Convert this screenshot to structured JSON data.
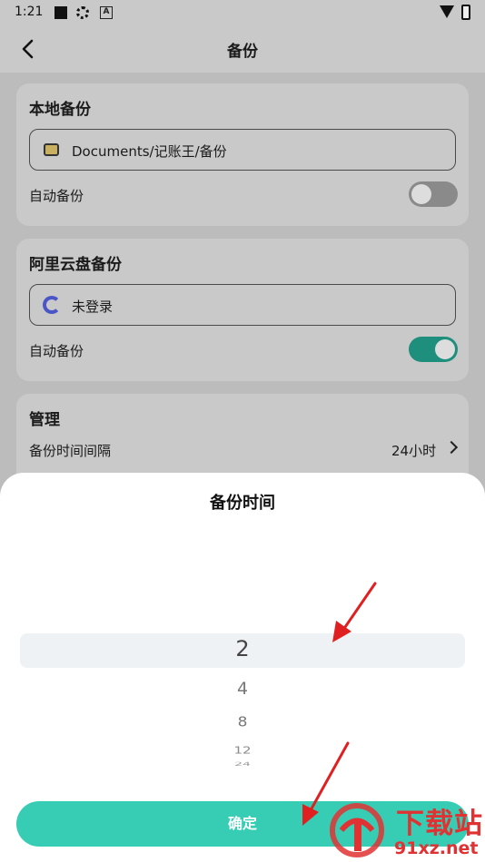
{
  "status_bar": {
    "time": "1:21"
  },
  "header": {
    "title": "备份"
  },
  "local_backup": {
    "title": "本地备份",
    "path": "Documents/记账王/备份",
    "auto_label": "自动备份",
    "auto_enabled": false
  },
  "cloud_backup": {
    "title": "阿里云盘备份",
    "account": "未登录",
    "auto_label": "自动备份",
    "auto_enabled": true
  },
  "manage": {
    "title": "管理",
    "interval_label": "备份时间间隔",
    "interval_value": "24小时"
  },
  "sheet": {
    "title": "备份时间",
    "picker_options": [
      "2",
      "4",
      "8",
      "12",
      "24"
    ],
    "selected": "2",
    "confirm_label": "确定"
  },
  "watermark": {
    "title": "下载站",
    "url": "91xz.net"
  },
  "colors": {
    "accent": "#36cdb4",
    "arrow": "#e02020",
    "cloud_icon": "#4a55c8"
  }
}
